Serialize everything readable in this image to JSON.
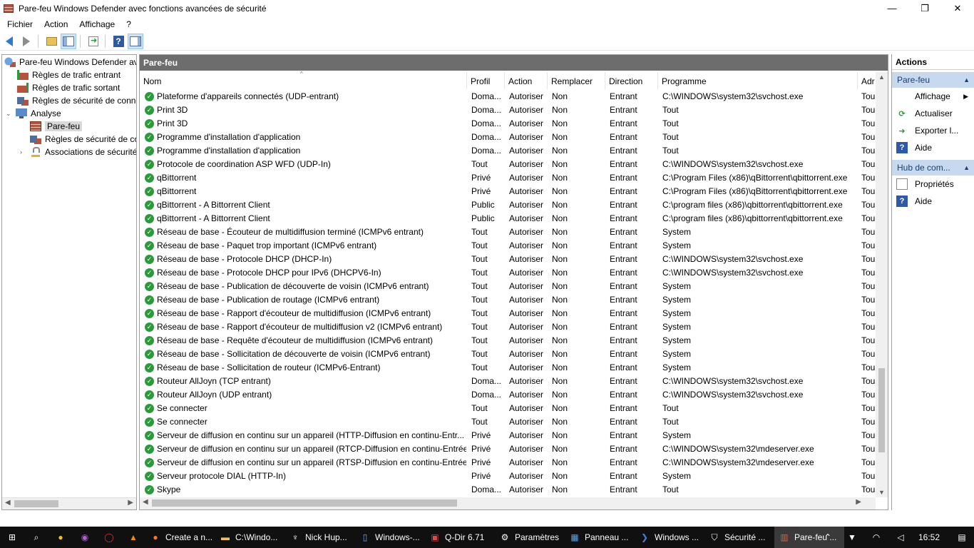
{
  "window": {
    "title": "Pare-feu Windows Defender avec fonctions avancées de sécurité",
    "minimize": "—",
    "maximize": "❐",
    "close": "✕"
  },
  "menu": [
    "Fichier",
    "Action",
    "Affichage",
    "?"
  ],
  "toolbar": {
    "icons": [
      "back-icon",
      "forward-icon",
      "up-folder-icon",
      "show-hide-tree-icon",
      "export-list-icon",
      "help-icon",
      "show-hide-action-pane-icon"
    ],
    "help_label": "?"
  },
  "tree": {
    "root": "Pare-feu Windows Defender av",
    "items": [
      {
        "label": "Règles de trafic entrant",
        "icon": "inbound-rules-icon"
      },
      {
        "label": "Règles de trafic sortant",
        "icon": "outbound-rules-icon"
      },
      {
        "label": "Règles de sécurité de conne",
        "icon": "connection-security-icon"
      },
      {
        "label": "Analyse",
        "icon": "monitoring-icon",
        "expander": "⌄"
      },
      {
        "label": "Pare-feu",
        "icon": "firewall-icon",
        "selected": true
      },
      {
        "label": "Règles de sécurité de co",
        "icon": "connection-security-icon"
      },
      {
        "label": "Associations de sécurité",
        "icon": "lock-icon",
        "expander": "›"
      }
    ]
  },
  "pane": {
    "title": "Pare-feu",
    "sort_caret": "^",
    "columns": [
      "Nom",
      "Profil",
      "Action",
      "Remplacer",
      "Direction",
      "Programme",
      "Adr"
    ],
    "rows": [
      [
        "Plateforme d'appareils connectés (UDP-entrant)",
        "Doma...",
        "Autoriser",
        "Non",
        "Entrant",
        "C:\\WINDOWS\\system32\\svchost.exe",
        "Tou"
      ],
      [
        "Print 3D",
        "Doma...",
        "Autoriser",
        "Non",
        "Entrant",
        "Tout",
        "Tou"
      ],
      [
        "Print 3D",
        "Doma...",
        "Autoriser",
        "Non",
        "Entrant",
        "Tout",
        "Tou"
      ],
      [
        "Programme d'installation d'application",
        "Doma...",
        "Autoriser",
        "Non",
        "Entrant",
        "Tout",
        "Tou"
      ],
      [
        "Programme d'installation d'application",
        "Doma...",
        "Autoriser",
        "Non",
        "Entrant",
        "Tout",
        "Tou"
      ],
      [
        "Protocole de coordination ASP WFD (UDP-In)",
        "Tout",
        "Autoriser",
        "Non",
        "Entrant",
        "C:\\WINDOWS\\system32\\svchost.exe",
        "Tou"
      ],
      [
        "qBittorrent",
        "Privé",
        "Autoriser",
        "Non",
        "Entrant",
        "C:\\Program Files (x86)\\qBittorrent\\qbittorrent.exe",
        "Tou"
      ],
      [
        "qBittorrent",
        "Privé",
        "Autoriser",
        "Non",
        "Entrant",
        "C:\\Program Files (x86)\\qBittorrent\\qbittorrent.exe",
        "Tou"
      ],
      [
        "qBittorrent - A Bittorrent Client",
        "Public",
        "Autoriser",
        "Non",
        "Entrant",
        "C:\\program files (x86)\\qbittorrent\\qbittorrent.exe",
        "Tou"
      ],
      [
        "qBittorrent - A Bittorrent Client",
        "Public",
        "Autoriser",
        "Non",
        "Entrant",
        "C:\\program files (x86)\\qbittorrent\\qbittorrent.exe",
        "Tou"
      ],
      [
        "Réseau de base - Écouteur de multidiffusion terminé (ICMPv6 entrant)",
        "Tout",
        "Autoriser",
        "Non",
        "Entrant",
        "System",
        "Tou"
      ],
      [
        "Réseau de base - Paquet trop important (ICMPv6 entrant)",
        "Tout",
        "Autoriser",
        "Non",
        "Entrant",
        "System",
        "Tou"
      ],
      [
        "Réseau de base - Protocole DHCP (DHCP-In)",
        "Tout",
        "Autoriser",
        "Non",
        "Entrant",
        "C:\\WINDOWS\\system32\\svchost.exe",
        "Tou"
      ],
      [
        "Réseau de base - Protocole DHCP pour IPv6 (DHCPV6-In)",
        "Tout",
        "Autoriser",
        "Non",
        "Entrant",
        "C:\\WINDOWS\\system32\\svchost.exe",
        "Tou"
      ],
      [
        "Réseau de base - Publication de découverte de voisin (ICMPv6 entrant)",
        "Tout",
        "Autoriser",
        "Non",
        "Entrant",
        "System",
        "Tou"
      ],
      [
        "Réseau de base - Publication de routage (ICMPv6 entrant)",
        "Tout",
        "Autoriser",
        "Non",
        "Entrant",
        "System",
        "Tou"
      ],
      [
        "Réseau de base - Rapport d'écouteur de multidiffusion (ICMPv6 entrant)",
        "Tout",
        "Autoriser",
        "Non",
        "Entrant",
        "System",
        "Tou"
      ],
      [
        "Réseau de base - Rapport d'écouteur de multidiffusion v2 (ICMPv6 entrant)",
        "Tout",
        "Autoriser",
        "Non",
        "Entrant",
        "System",
        "Tou"
      ],
      [
        "Réseau de base - Requête d'écouteur de multidiffusion (ICMPv6 entrant)",
        "Tout",
        "Autoriser",
        "Non",
        "Entrant",
        "System",
        "Tou"
      ],
      [
        "Réseau de base - Sollicitation de découverte de voisin (ICMPv6 entrant)",
        "Tout",
        "Autoriser",
        "Non",
        "Entrant",
        "System",
        "Tou"
      ],
      [
        "Réseau de base - Sollicitation de routeur (ICMPv6-Entrant)",
        "Tout",
        "Autoriser",
        "Non",
        "Entrant",
        "System",
        "Tou"
      ],
      [
        "Routeur AllJoyn (TCP entrant)",
        "Doma...",
        "Autoriser",
        "Non",
        "Entrant",
        "C:\\WINDOWS\\system32\\svchost.exe",
        "Tou"
      ],
      [
        "Routeur AllJoyn (UDP entrant)",
        "Doma...",
        "Autoriser",
        "Non",
        "Entrant",
        "C:\\WINDOWS\\system32\\svchost.exe",
        "Tou"
      ],
      [
        "Se connecter",
        "Tout",
        "Autoriser",
        "Non",
        "Entrant",
        "Tout",
        "Tou"
      ],
      [
        "Se connecter",
        "Tout",
        "Autoriser",
        "Non",
        "Entrant",
        "Tout",
        "Tou"
      ],
      [
        "Serveur de diffusion en continu sur un appareil (HTTP-Diffusion en continu-Entr...",
        "Privé",
        "Autoriser",
        "Non",
        "Entrant",
        "System",
        "Tou"
      ],
      [
        "Serveur de diffusion en continu sur un appareil (RTCP-Diffusion en continu-Entrée)",
        "Privé",
        "Autoriser",
        "Non",
        "Entrant",
        "C:\\WINDOWS\\system32\\mdeserver.exe",
        "Tou"
      ],
      [
        "Serveur de diffusion en continu sur un appareil (RTSP-Diffusion en continu-Entrée)",
        "Privé",
        "Autoriser",
        "Non",
        "Entrant",
        "C:\\WINDOWS\\system32\\mdeserver.exe",
        "Tou"
      ],
      [
        "Serveur protocole DIAL (HTTP-In)",
        "Privé",
        "Autoriser",
        "Non",
        "Entrant",
        "System",
        "Tou"
      ],
      [
        "Skype",
        "Doma...",
        "Autoriser",
        "Non",
        "Entrant",
        "Tout",
        "Tou"
      ]
    ]
  },
  "actions": {
    "title": "Actions",
    "sections": [
      {
        "label": "Pare-feu",
        "items": [
          {
            "label": "Affichage",
            "icon": "none",
            "submenu": true
          },
          {
            "label": "Actualiser",
            "icon": "refresh-icon"
          },
          {
            "label": "Exporter l...",
            "icon": "export-icon"
          },
          {
            "label": "Aide",
            "icon": "help-icon"
          }
        ]
      },
      {
        "label": "Hub de com...",
        "items": [
          {
            "label": "Propriétés",
            "icon": "properties-icon"
          },
          {
            "label": "Aide",
            "icon": "help-icon"
          }
        ]
      }
    ]
  },
  "taskbar": {
    "apps": [
      {
        "label": "Create a n...",
        "icon": "firefox-icon"
      },
      {
        "label": "C:\\Windo...",
        "icon": "folder-icon"
      },
      {
        "label": "Nick Hup...",
        "icon": "nick-icon"
      },
      {
        "label": "Windows-...",
        "icon": "document-icon"
      },
      {
        "label": "Q-Dir 6.71",
        "icon": "qdir-icon"
      },
      {
        "label": "Paramètres",
        "icon": "settings-icon"
      },
      {
        "label": "Panneau ...",
        "icon": "control-panel-icon"
      },
      {
        "label": "Windows ...",
        "icon": "powershell-icon"
      },
      {
        "label": "Sécurité ...",
        "icon": "shield-icon"
      },
      {
        "label": "Pare-feu ...",
        "icon": "firewall-icon",
        "active": true
      }
    ],
    "clock": "16:52"
  }
}
